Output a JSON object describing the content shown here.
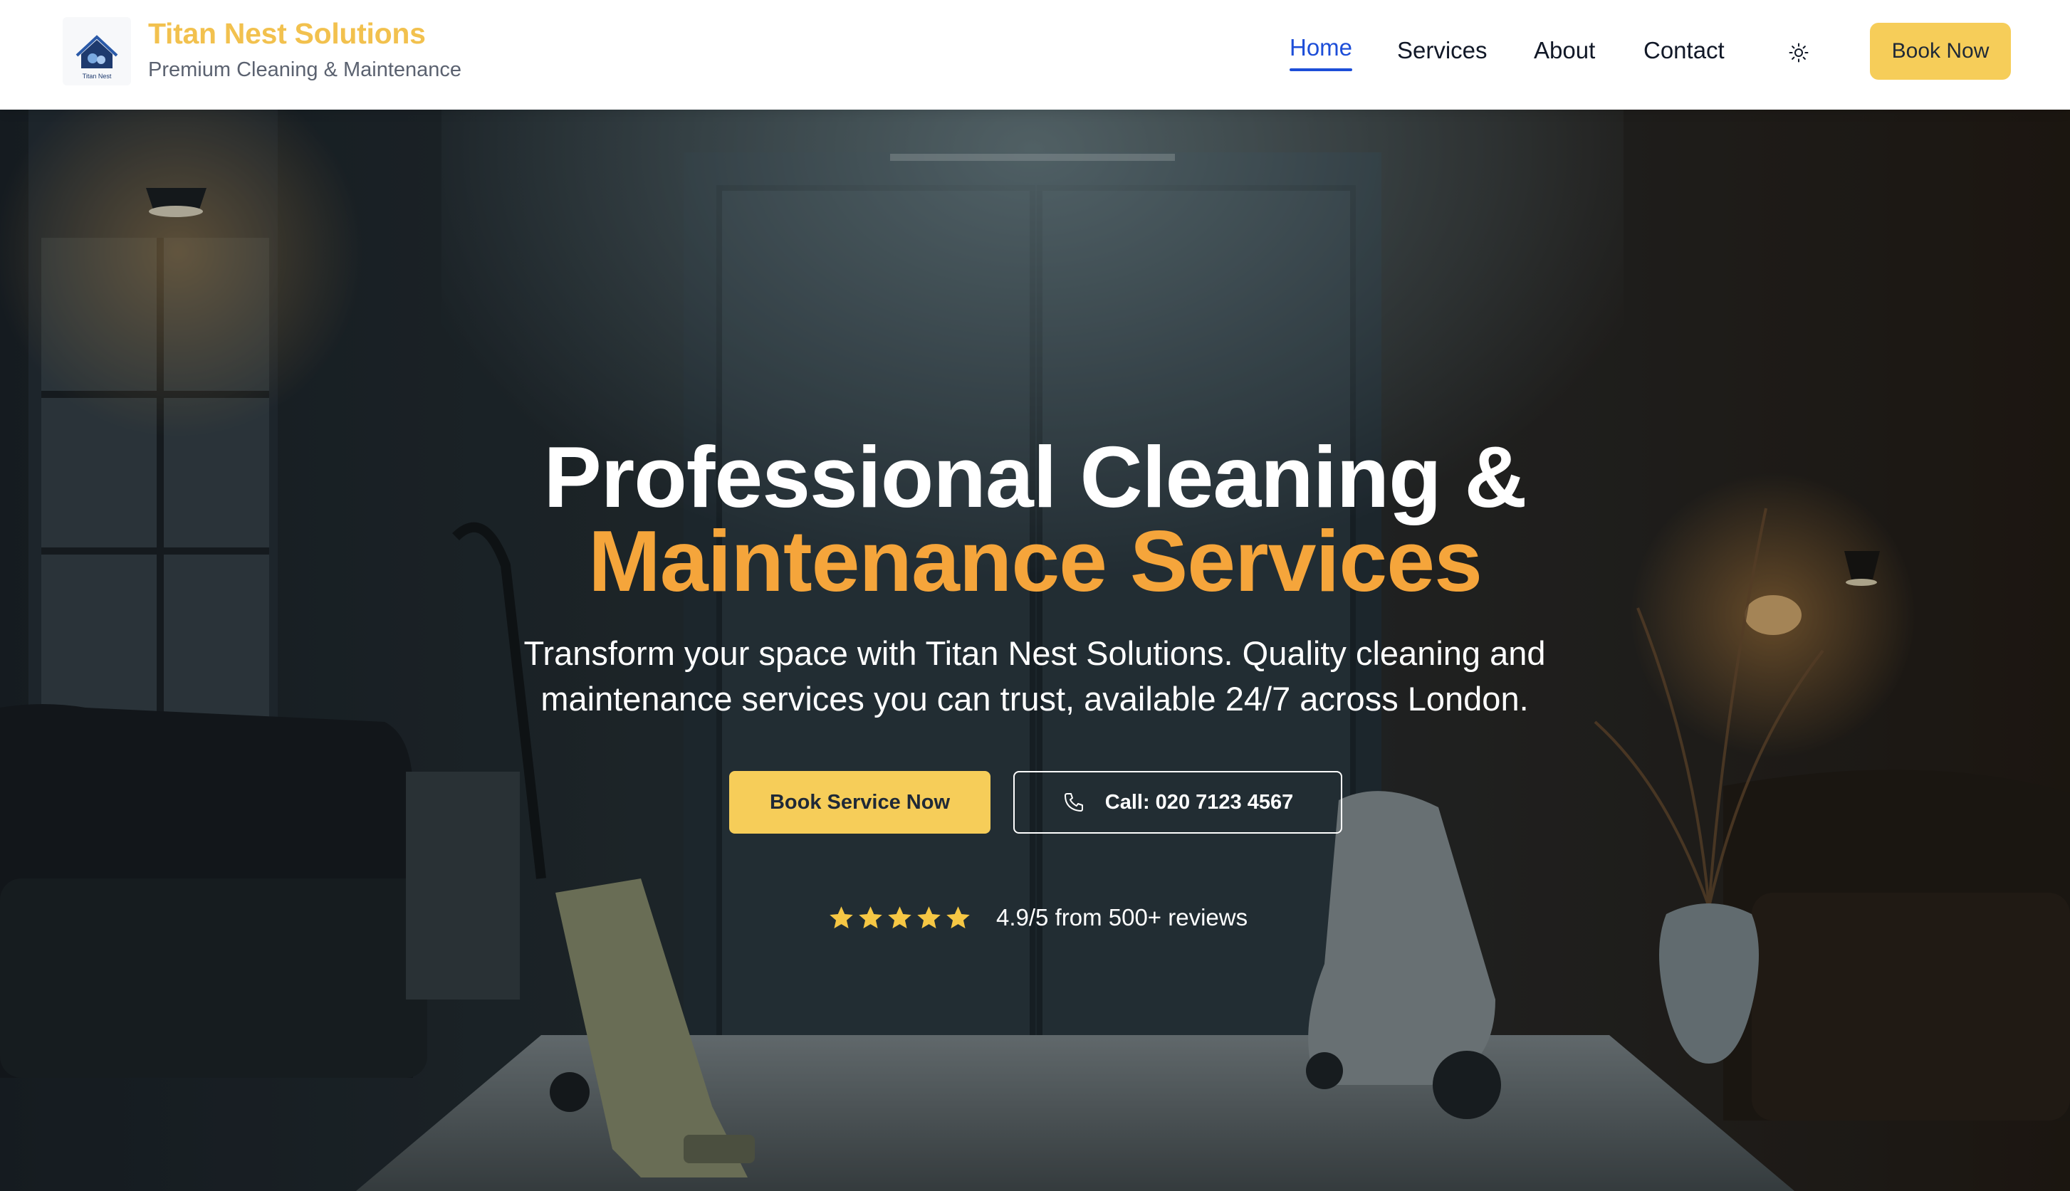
{
  "brand": {
    "logo_alt": "Titan Nest",
    "name": "Titan Nest Solutions",
    "tagline": "Premium Cleaning & Maintenance"
  },
  "nav": {
    "items": [
      {
        "label": "Home",
        "active": true
      },
      {
        "label": "Services",
        "active": false
      },
      {
        "label": "About",
        "active": false
      },
      {
        "label": "Contact",
        "active": false
      }
    ],
    "theme_toggle_icon": "sun-icon",
    "book_now_label": "Book Now"
  },
  "hero": {
    "title_line1": "Professional Cleaning &",
    "title_line2": "Maintenance Services",
    "subtitle": "Transform your space with Titan Nest Solutions. Quality cleaning and maintenance services you can trust, available 24/7 across London.",
    "primary_button_label": "Book Service Now",
    "call_button_label": "Call: 020 7123 4567",
    "call_icon": "phone-icon",
    "rating_stars": 5,
    "rating_text": "4.9/5 from 500+ reviews"
  },
  "colors": {
    "brand_gold": "#f2c14e",
    "button_yellow": "#f6cd59",
    "accent_orange": "#f5a53b",
    "active_link_blue": "#1d4ed8"
  }
}
